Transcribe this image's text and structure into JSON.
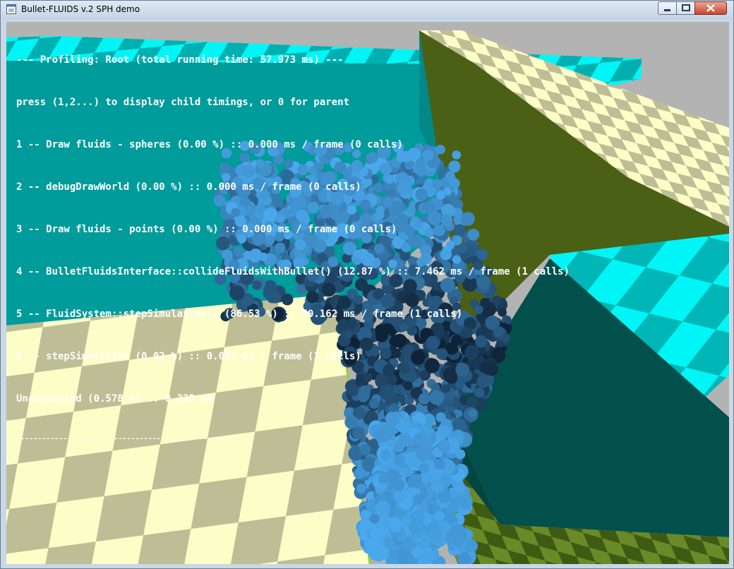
{
  "window": {
    "title": "Bullet-FLUIDS v.2 SPH demo",
    "controls": [
      "minimize",
      "maximize",
      "close"
    ]
  },
  "icons": {
    "app": "window-app-icon",
    "minimize": "minimize-icon",
    "maximize": "maximize-icon",
    "close": "close-icon"
  },
  "colors": {
    "fluid_light": "#4aa8ec",
    "fluid_dark": "#0c1c2e",
    "box_teal": "#009b9b",
    "box_dark_teal": "#02504c",
    "box_olive": "#4a6014",
    "checker_cyan": "#00f6f6",
    "checker_cream": "#fdfdc7",
    "checker_tan": "#bebe96"
  },
  "profiler": {
    "header": "--- Profiling: Root (total running time: 57.973 ms) ---",
    "hint": "press (1,2...) to display child timings, or 0 for parent",
    "lines": [
      "1 -- Draw fluids - spheres (0.00 %) :: 0.000 ms / frame (0 calls)",
      "2 -- debugDrawWorld (0.00 %) :: 0.000 ms / frame (0 calls)",
      "3 -- Draw fluids - points (0.00 %) :: 0.000 ms / frame (0 calls)",
      "4 -- BulletFluidsInterface::collideFluidsWithBullet() (12.87 %) :: 7.462 ms / frame (1 calls)",
      "5 -- FluidSystem::stepSimulation() (86.53 %) :: 50.162 ms / frame (1 calls)",
      "6 -- stepSimulation (0.02 %) :: 0.014 ms / frame (1 calls)"
    ],
    "unaccounted": "Unaccounted (0.578 %) :: 0.335 ms",
    "separator": "-------------------------------------------------"
  }
}
